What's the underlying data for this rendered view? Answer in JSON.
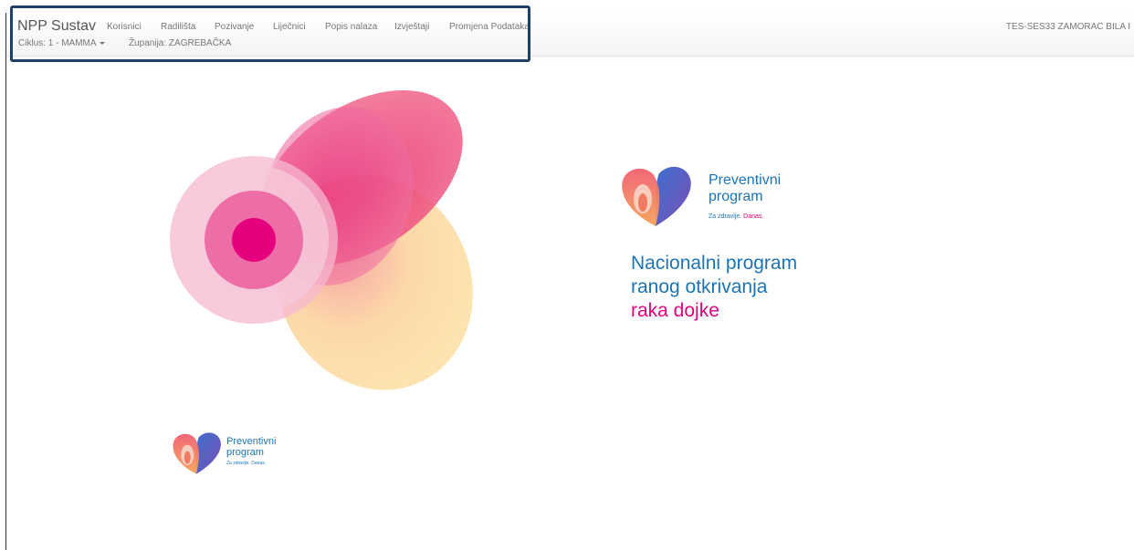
{
  "navbar": {
    "brand": "NPP Sustav",
    "items": [
      {
        "label": "Korisnici"
      },
      {
        "label": "Radilišta"
      },
      {
        "label": "Pozivanje"
      },
      {
        "label": "Liječnici"
      },
      {
        "label": "Popis nalaza"
      },
      {
        "label": "Izvještaji"
      },
      {
        "label": "Promjena Podataka"
      }
    ],
    "cycle_label": "Ciklus: 1 - MAMMA",
    "county_label": "Županija: ZAGREBAČKA",
    "user_label": "TES-SES33 ZAMORAC BILA I"
  },
  "logo": {
    "line1": "Preventivni",
    "line2": "program",
    "tagline_prefix": "Za zdravlje.",
    "tagline_emphasis": "Danas."
  },
  "headline": {
    "line1": "Nacionalni program",
    "line2": "ranog otkrivanja",
    "line3": "raka dojke"
  },
  "colors": {
    "brand_blue": "#1b74b8",
    "brand_pink": "#e6007e",
    "highlight_border": "#1f3f6b"
  },
  "icons": [
    "heart-logo-icon",
    "caret-down-icon"
  ]
}
